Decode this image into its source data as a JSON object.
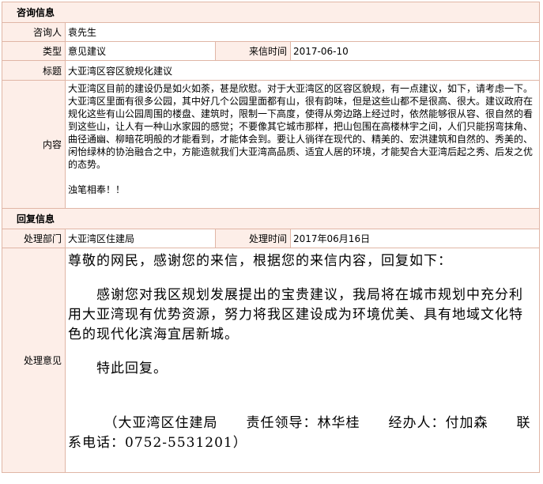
{
  "consult": {
    "section_title": "咨询信息",
    "consultant_label": "咨询人",
    "consultant_value": "袁先生",
    "type_label": "类型",
    "type_value": "意见建议",
    "date_label": "来信时间",
    "date_value": "2017-06-10",
    "subject_label": "标题",
    "subject_value": "大亚湾区容区貌规化建议",
    "content_label": "内容",
    "content_p1": "大亚湾区目前的建设仍是如火如荼，甚是欣慰。对于大亚湾区的区容区貌规，有一点建议，如下，请考虑一下。",
    "content_p2": "大亚湾区里面有很多公园，其中好几个公园里面都有山，很有韵味，但是这些山都不是很高、很大。建议政府在规化这些有山公园周围的楼盘、建筑时，限制一下高度，使得从旁边路上经过时，依然能够很从容、很自然的看到这些山，让人有一种山水家园的感觉；不要像其它城市那样，把山包围在高楼林宇之间，人们只能拐弯抹角、曲径通幽、柳暗花明般的才能看到，才能体会到。要让人徜徉在现代的、精美的、宏洪建筑和自然的、秀美的、闲怡绿林的协治融合之中，方能造就我们大亚湾高品质、适宜人居的环境，才能契合大亚湾后起之秀、后发之优的态势。",
    "content_p3": "浊笔相奉！！"
  },
  "reply": {
    "section_title": "回复信息",
    "dept_label": "处理部门",
    "dept_value": "大亚湾区住建局",
    "time_label": "处理时间",
    "time_value": "2017年06月16日",
    "opinion_label": "处理意见",
    "greeting": "尊敬的网民，感谢您的来信，根据您的来信内容，回复如下：",
    "body": "　　感谢您对我区规划发展提出的宝贵建议，我局将在城市规划中充分利用大亚湾现有优势资源，努力将我区建设成为环境优美、具有地域文化特色的现代化滨海宜居新城。",
    "closing": "　　特此回复。",
    "signature": "　　　（大亚湾区住建局　　责任领导：林华桂　　经办人：付加森　　联系电话：0752-5531201）"
  },
  "colors": {
    "border": "#e0b6a6",
    "label_bg": "#fdeee8"
  }
}
